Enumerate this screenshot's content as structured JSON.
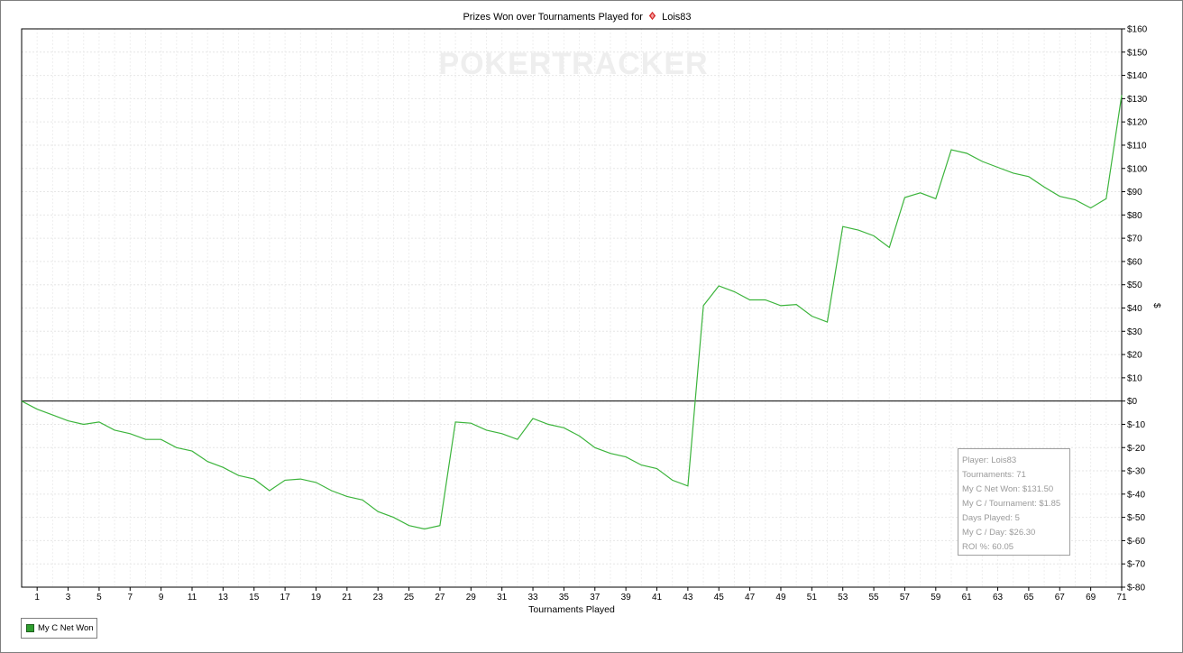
{
  "chart_data": {
    "type": "line",
    "title_prefix": "Prizes Won over Tournaments Played for",
    "player": "Lois83",
    "suit_icon": "poker-chip-icon",
    "xlabel": "Tournaments Played",
    "ylabel": "$",
    "xlim": [
      0,
      71
    ],
    "ylim": [
      -80,
      160
    ],
    "y_ticks": [
      160,
      150,
      140,
      130,
      120,
      110,
      100,
      90,
      80,
      70,
      60,
      50,
      40,
      30,
      20,
      10,
      0,
      -10,
      -20,
      -30,
      -40,
      -50,
      -60,
      -70,
      -80
    ],
    "y_tick_labels": [
      "$160",
      "$150",
      "$140",
      "$130",
      "$120",
      "$110",
      "$100",
      "$90",
      "$80",
      "$70",
      "$60",
      "$50",
      "$40",
      "$30",
      "$20",
      "$10",
      "$0",
      "$-10",
      "$-20",
      "$-30",
      "$-40",
      "$-50",
      "$-60",
      "$-70",
      "$-80"
    ],
    "x_ticks": [
      1,
      3,
      5,
      7,
      9,
      11,
      13,
      15,
      17,
      19,
      21,
      23,
      25,
      27,
      29,
      31,
      33,
      35,
      37,
      39,
      41,
      43,
      45,
      47,
      49,
      51,
      53,
      55,
      57,
      59,
      61,
      63,
      65,
      67,
      69,
      71
    ],
    "x_tick_labels": [
      "1",
      "3",
      "5",
      "7",
      "9",
      "11",
      "13",
      "15",
      "17",
      "19",
      "21",
      "23",
      "25",
      "27",
      "29",
      "31",
      "33",
      "35",
      "37",
      "39",
      "41",
      "43",
      "45",
      "47",
      "49",
      "51",
      "53",
      "55",
      "57",
      "59",
      "61",
      "63",
      "65",
      "67",
      "69",
      "71"
    ],
    "grid": true,
    "legend_position": "bottom-left",
    "series": [
      {
        "name": "My C Net Won",
        "color": "#3cb43c",
        "x": [
          0,
          1,
          2,
          3,
          4,
          5,
          6,
          7,
          8,
          9,
          10,
          11,
          12,
          13,
          14,
          15,
          16,
          17,
          18,
          19,
          20,
          21,
          22,
          23,
          24,
          25,
          26,
          27,
          28,
          29,
          30,
          31,
          32,
          33,
          34,
          35,
          36,
          37,
          38,
          39,
          40,
          41,
          42,
          43,
          44,
          45,
          46,
          47,
          48,
          49,
          50,
          51,
          52,
          53,
          54,
          55,
          56,
          57,
          58,
          59,
          60,
          61,
          62,
          63,
          64,
          65,
          66,
          67,
          68,
          69,
          70,
          71
        ],
        "y": [
          0,
          -3.5,
          -6,
          -8.5,
          -10,
          -9,
          -12.5,
          -14,
          -16.5,
          -16.5,
          -20,
          -21.5,
          -26,
          -28.5,
          -32,
          -33.5,
          -38.5,
          -34,
          -33.5,
          -35,
          -38.5,
          -41,
          -42.5,
          -47.5,
          -50,
          -53.5,
          -55,
          -53.5,
          -9,
          -9.5,
          -12.5,
          -14,
          -16.5,
          -7.5,
          -10,
          -11.5,
          -15,
          -20,
          -22.5,
          -24,
          -27.5,
          -29,
          -34,
          -36.5,
          41,
          49.5,
          47,
          43.5,
          43.5,
          41,
          41.5,
          36.5,
          34,
          75,
          73.5,
          71,
          66,
          87.5,
          89.5,
          87,
          108,
          106.5,
          103,
          100.5,
          98,
          96.5,
          92,
          88,
          86.5,
          83,
          87,
          131.5
        ]
      }
    ],
    "watermark": "POKERTRACKER"
  },
  "stats": {
    "player": "Player: Lois83",
    "tournaments": "Tournaments: 71",
    "net_won": "My C Net Won: $131.50",
    "per_tournament": "My C / Tournament: $1.85",
    "days_played": "Days Played: 5",
    "per_day": "My C / Day: $26.30",
    "roi": "ROI %: 60.05"
  },
  "legend": {
    "label": "My C Net Won",
    "color": "#2f9e2f"
  }
}
